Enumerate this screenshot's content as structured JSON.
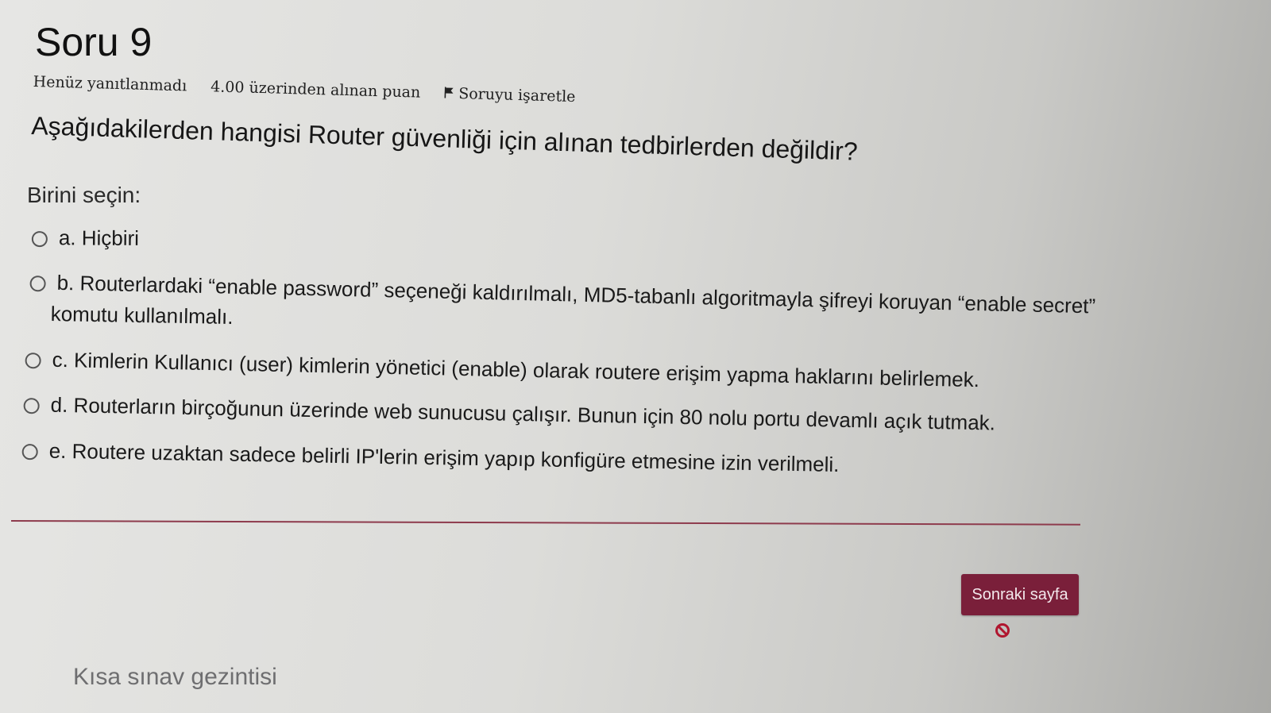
{
  "question": {
    "title": "Soru 9",
    "status": "Henüz yanıtlanmadı",
    "score": "4.00 üzerinden alınan puan",
    "flag_label": "Soruyu işaretle",
    "text": "Aşağıdakilerden hangisi Router güvenliği için alınan tedbirlerden değildir?",
    "prompt": "Birini seçin:"
  },
  "answers": [
    {
      "label": "a. Hiçbiri"
    },
    {
      "label": "b. Routerlardaki “enable password” seçeneği kaldırılmalı, MD5-tabanlı algoritmayla şifreyi koruyan “enable secret”",
      "continuation": "komutu kullanılmalı."
    },
    {
      "label": "c. Kimlerin Kullanıcı (user) kimlerin yönetici (enable) olarak routere erişim yapma haklarını belirlemek."
    },
    {
      "label": "d. Routerların birçoğunun üzerinde web sunucusu çalışır. Bunun için 80 nolu portu devamlı açık tutmak."
    },
    {
      "label": "e. Routere uzaktan sadece belirli IP'lerin erişim yapıp konfigüre etmesine izin verilmeli."
    }
  ],
  "navigation": {
    "next_button": "Sonraki sayfa",
    "quiz_navigation": "Kısa sınav gezintisi"
  },
  "icons": {
    "flag": "flag-icon",
    "blocked": "blocked-icon"
  },
  "colors": {
    "accent": "#7a1f3a",
    "divider": "#8e3b4d",
    "blocked": "#b0162f"
  }
}
